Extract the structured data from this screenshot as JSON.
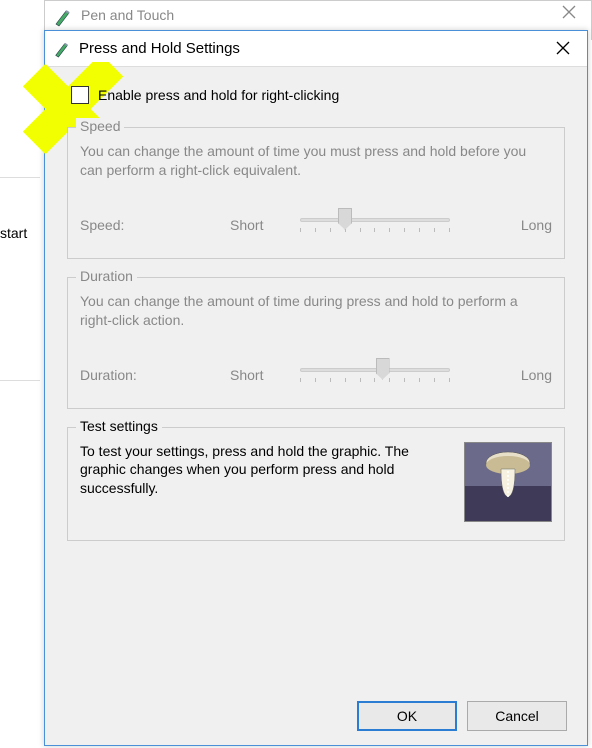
{
  "parent_window": {
    "title": "Pen and Touch"
  },
  "bg": {
    "start_fragment": "start"
  },
  "dialog": {
    "title": "Press and Hold Settings",
    "enable_label": "Enable press and hold for right-clicking",
    "enable_checked": false,
    "speed": {
      "legend": "Speed",
      "desc": "You can change the amount of time you must press and hold before you can perform a right-click equivalent.",
      "label": "Speed:",
      "min_label": "Short",
      "max_label": "Long",
      "value_pct": 30
    },
    "duration": {
      "legend": "Duration",
      "desc": "You can change the amount of time during press and hold to perform a right-click action.",
      "label": "Duration:",
      "min_label": "Short",
      "max_label": "Long",
      "value_pct": 55
    },
    "test": {
      "legend": "Test settings",
      "desc": "To test your settings, press and hold the graphic. The graphic changes when you perform press and hold successfully."
    },
    "buttons": {
      "ok": "OK",
      "cancel": "Cancel"
    }
  }
}
